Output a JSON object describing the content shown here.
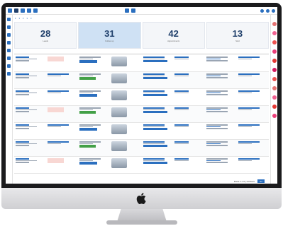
{
  "stats": [
    {
      "value": "28",
      "label": "Leads",
      "active": false
    },
    {
      "value": "31",
      "label": "Follow up",
      "active": true
    },
    {
      "value": "42",
      "label": "Appointments",
      "active": false
    },
    {
      "value": "13",
      "label": "Sold",
      "active": false
    }
  ],
  "pagination": {
    "range": "Rows: 1-13  |  14 Rows",
    "button": "Go"
  },
  "colors": {
    "accent": "#2b6fbf",
    "active_stat": "#cfe1f4",
    "success": "#43a047",
    "warning_bg": "#f8d7d3"
  }
}
